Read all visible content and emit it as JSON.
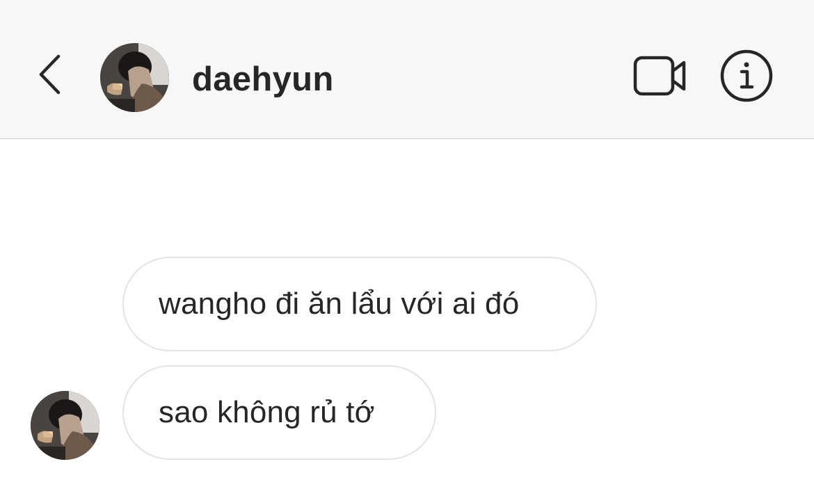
{
  "header": {
    "username": "daehyun",
    "back_icon": "chevron-left-icon",
    "video_icon": "video-camera-icon",
    "info_icon": "info-icon"
  },
  "messages": [
    {
      "text": "wangho đi ăn lẩu với ai đó",
      "sender": "daehyun"
    },
    {
      "text": "sao không rủ tớ",
      "sender": "daehyun"
    }
  ],
  "colors": {
    "header_bg": "#f7f7f7",
    "text": "#262626",
    "bubble_border": "#e3e3e3",
    "divider": "#cfcfcf"
  }
}
